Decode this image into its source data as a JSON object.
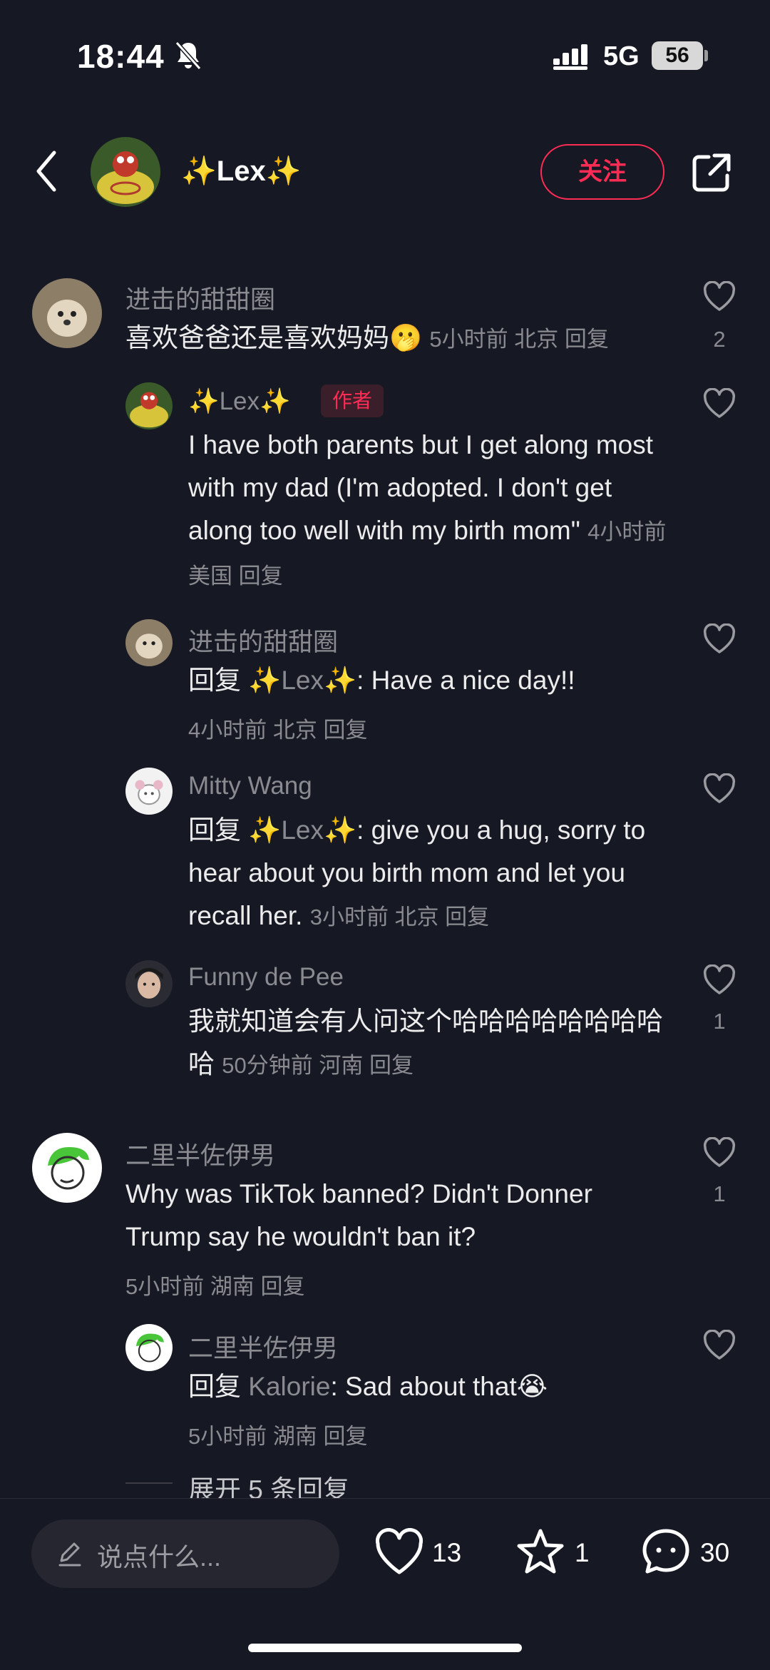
{
  "status_bar": {
    "time": "18:44",
    "network": "5G",
    "battery": "56"
  },
  "header": {
    "name": "✨Lex✨",
    "follow_label": "关注"
  },
  "comments": [
    {
      "user": "进击的甜甜圈",
      "text": "喜欢爸爸还是喜欢妈妈",
      "meta": "5小时前 北京 回复",
      "likes": "2"
    },
    {
      "user": "✨Lex✨",
      "badge": "作者",
      "text": "I have both parents but I get along most with my dad (I'm adopted. I don't get along too well with my birth mom\"",
      "meta": "4小时前 美国 回复"
    },
    {
      "user": "进击的甜甜圈",
      "reply_prefix": "回复 ",
      "reply_to": "✨Lex✨",
      "text": ": Have a nice day!!",
      "meta": "4小时前 北京 回复"
    },
    {
      "user": "Mitty Wang",
      "reply_prefix": "回复 ",
      "reply_to": "✨Lex✨",
      "text": ": give you a hug, sorry to hear about you birth mom and let you recall her.",
      "meta": "3小时前 北京 回复"
    },
    {
      "user": "Funny de Pee",
      "text": "我就知道会有人问这个哈哈哈哈哈哈哈哈哈",
      "meta": "50分钟前 河南 回复",
      "likes": "1"
    },
    {
      "user": "二里半佐伊男",
      "text": "Why was TikTok banned? Didn't Donner Trump say he wouldn't ban it?",
      "meta": "5小时前 湖南 回复",
      "likes": "1"
    },
    {
      "user": "二里半佐伊男",
      "reply_prefix": "回复 ",
      "reply_to": "Kalorie",
      "text": ": Sad about that",
      "meta": "5小时前 湖南 回复"
    }
  ],
  "expand_replies": "展开 5 条回复",
  "bottom_bar": {
    "input_placeholder": "说点什么...",
    "likes": "13",
    "favorites": "1",
    "comments": "30"
  },
  "colors": {
    "background": "#161823",
    "accent": "#fe2c55",
    "muted": "#8a8b91"
  }
}
